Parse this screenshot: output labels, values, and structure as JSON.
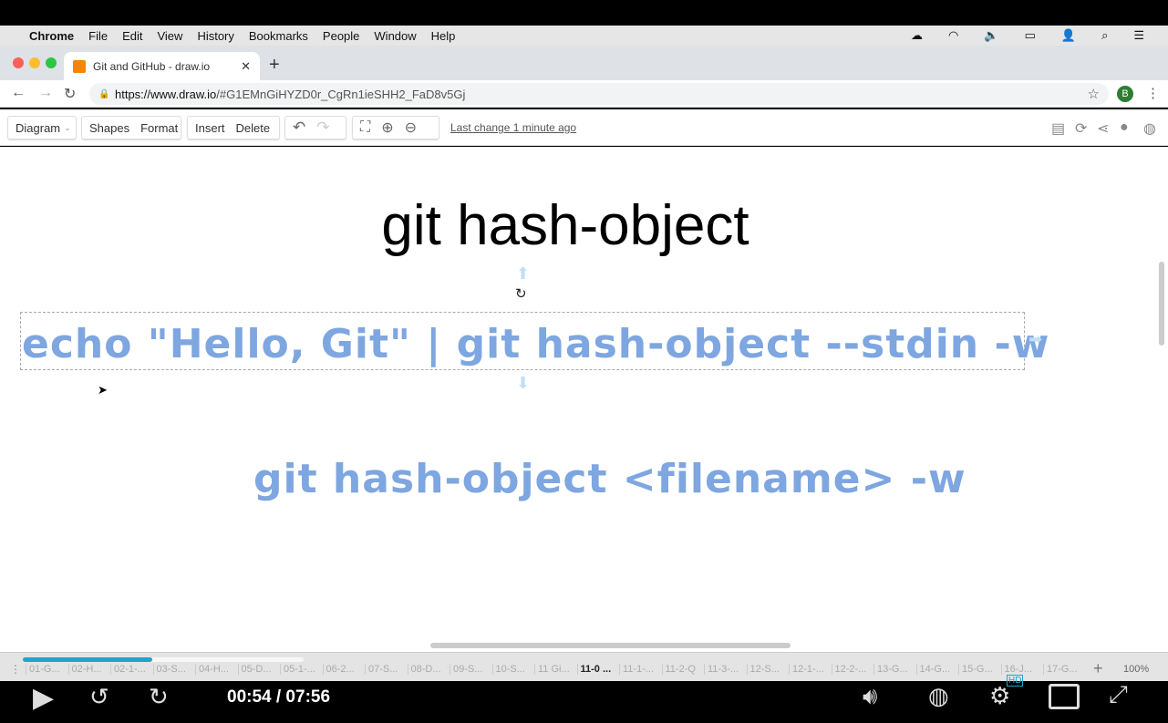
{
  "menubar": {
    "app": "Chrome",
    "items": [
      "File",
      "Edit",
      "View",
      "History",
      "Bookmarks",
      "People",
      "Window",
      "Help"
    ]
  },
  "browser": {
    "tab_title": "Git and GitHub - draw.io",
    "url_host": "https://www.draw.io",
    "url_path": "/#G1EMnGiHYZD0r_CgRn1ieSHH2_FaD8v5Gj",
    "profile_initial": "B"
  },
  "toolbar": {
    "diagram": "Diagram",
    "shapes": "Shapes",
    "format": "Format",
    "insert": "Insert",
    "delete": "Delete",
    "last_change": "Last change 1 minute ago"
  },
  "canvas": {
    "title": "git hash-object",
    "command1": "echo \"Hello, Git\" | git hash-object --stdin -w",
    "command2": "git hash-object <filename> -w"
  },
  "pages": {
    "tabs": [
      "01-G...",
      "02-H...",
      "02-1-...",
      "03-S...",
      "04-H...",
      "05-D...",
      "05-1-...",
      "06-2...",
      "07-S...",
      "08-D...",
      "09-S...",
      "10-S...",
      "11 Gi...",
      "11-0 ...",
      "11-1-...",
      "11-2-Q",
      "11-3-...",
      "12-S...",
      "12-1-...",
      "12-2-...",
      "13-G...",
      "14-G...",
      "15-G...",
      "16-J...",
      "17-G..."
    ],
    "active_index": 13,
    "zoom": "100%"
  },
  "video": {
    "time": "00:54 / 07:56",
    "progress_percent": 11.3,
    "hd_badge": "HD",
    "accent": "#1ea7c5"
  }
}
